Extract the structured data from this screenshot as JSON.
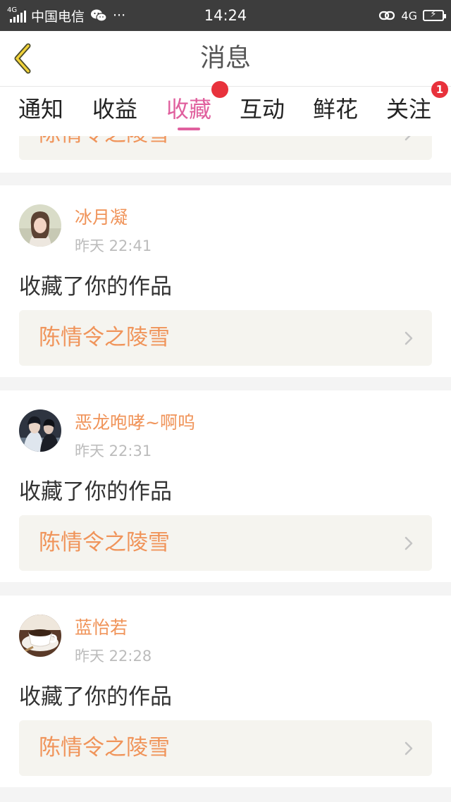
{
  "status_bar": {
    "network": "4G",
    "carrier": "中国电信",
    "more": "···",
    "time": "14:24",
    "right_network": "4G",
    "charging": "⚡"
  },
  "header": {
    "title": "消息"
  },
  "tabs": [
    {
      "label": "通知",
      "active": false
    },
    {
      "label": "收益",
      "active": false
    },
    {
      "label": "收藏",
      "active": true,
      "badge": ""
    },
    {
      "label": "互动",
      "active": false
    },
    {
      "label": "鲜花",
      "active": false
    },
    {
      "label": "关注",
      "active": false,
      "badge": "1"
    }
  ],
  "partial_card": {
    "work_title": "陈情令之陵雪"
  },
  "cards": [
    {
      "user": "冰月凝",
      "time": "昨天 22:41",
      "action": "收藏了你的作品",
      "work_title": "陈情令之陵雪",
      "avatar": "portrait-avatar"
    },
    {
      "user": "恶龙咆哮~啊呜",
      "time": "昨天 22:31",
      "action": "收藏了你的作品",
      "work_title": "陈情令之陵雪",
      "avatar": "couple-avatar"
    },
    {
      "user": "蓝怡若",
      "time": "昨天 22:28",
      "action": "收藏了你的作品",
      "work_title": "陈情令之陵雪",
      "avatar": "coffee-avatar"
    }
  ],
  "colors": {
    "accent": "#e0609e",
    "link_text": "#f0945a",
    "badge": "#e8323c",
    "status_bar": "#3d3d3d"
  }
}
